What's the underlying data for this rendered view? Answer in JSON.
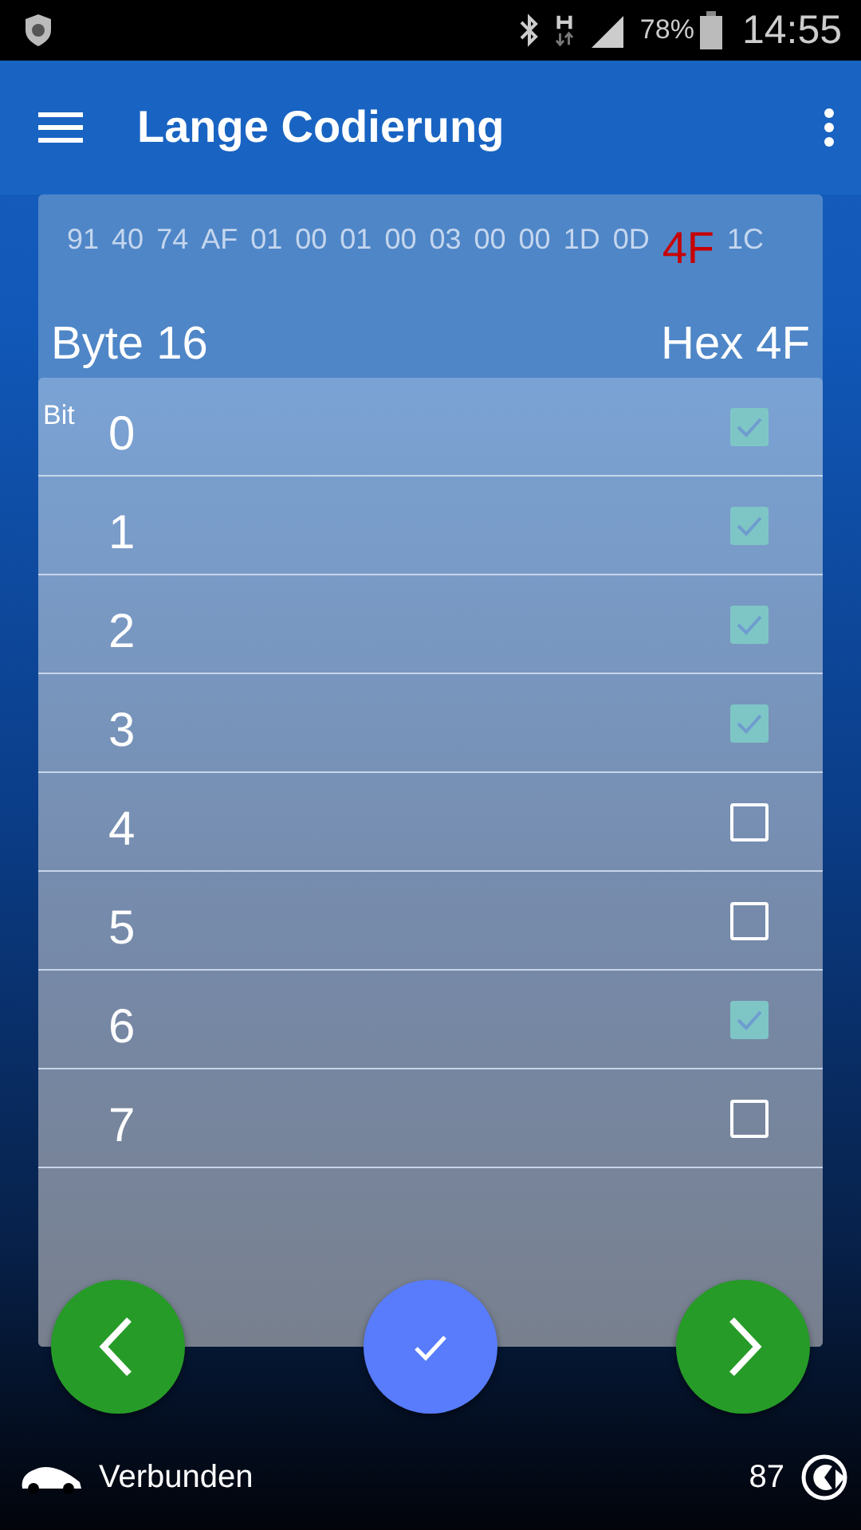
{
  "status_bar": {
    "battery": "78%",
    "time": "14:55"
  },
  "app_bar": {
    "title": "Lange Codierung"
  },
  "hex_strip": [
    {
      "text": "91",
      "selected": false
    },
    {
      "text": "40",
      "selected": false
    },
    {
      "text": "74",
      "selected": false
    },
    {
      "text": "AF",
      "selected": false
    },
    {
      "text": "01",
      "selected": false
    },
    {
      "text": "00",
      "selected": false
    },
    {
      "text": "01",
      "selected": false
    },
    {
      "text": "00",
      "selected": false
    },
    {
      "text": "03",
      "selected": false
    },
    {
      "text": "00",
      "selected": false
    },
    {
      "text": "00",
      "selected": false
    },
    {
      "text": "1D",
      "selected": false
    },
    {
      "text": "0D",
      "selected": false
    },
    {
      "text": "4F",
      "selected": true
    },
    {
      "text": "1C",
      "selected": false
    }
  ],
  "byte_label": "Byte 16",
  "hex_label": "Hex 4F",
  "bit_caption": "Bit",
  "bits": [
    {
      "label": "0",
      "checked": true
    },
    {
      "label": "1",
      "checked": true
    },
    {
      "label": "2",
      "checked": true
    },
    {
      "label": "3",
      "checked": true
    },
    {
      "label": "4",
      "checked": false
    },
    {
      "label": "5",
      "checked": false
    },
    {
      "label": "6",
      "checked": true
    },
    {
      "label": "7",
      "checked": false
    }
  ],
  "footer": {
    "status": "Verbunden",
    "count": "87"
  }
}
